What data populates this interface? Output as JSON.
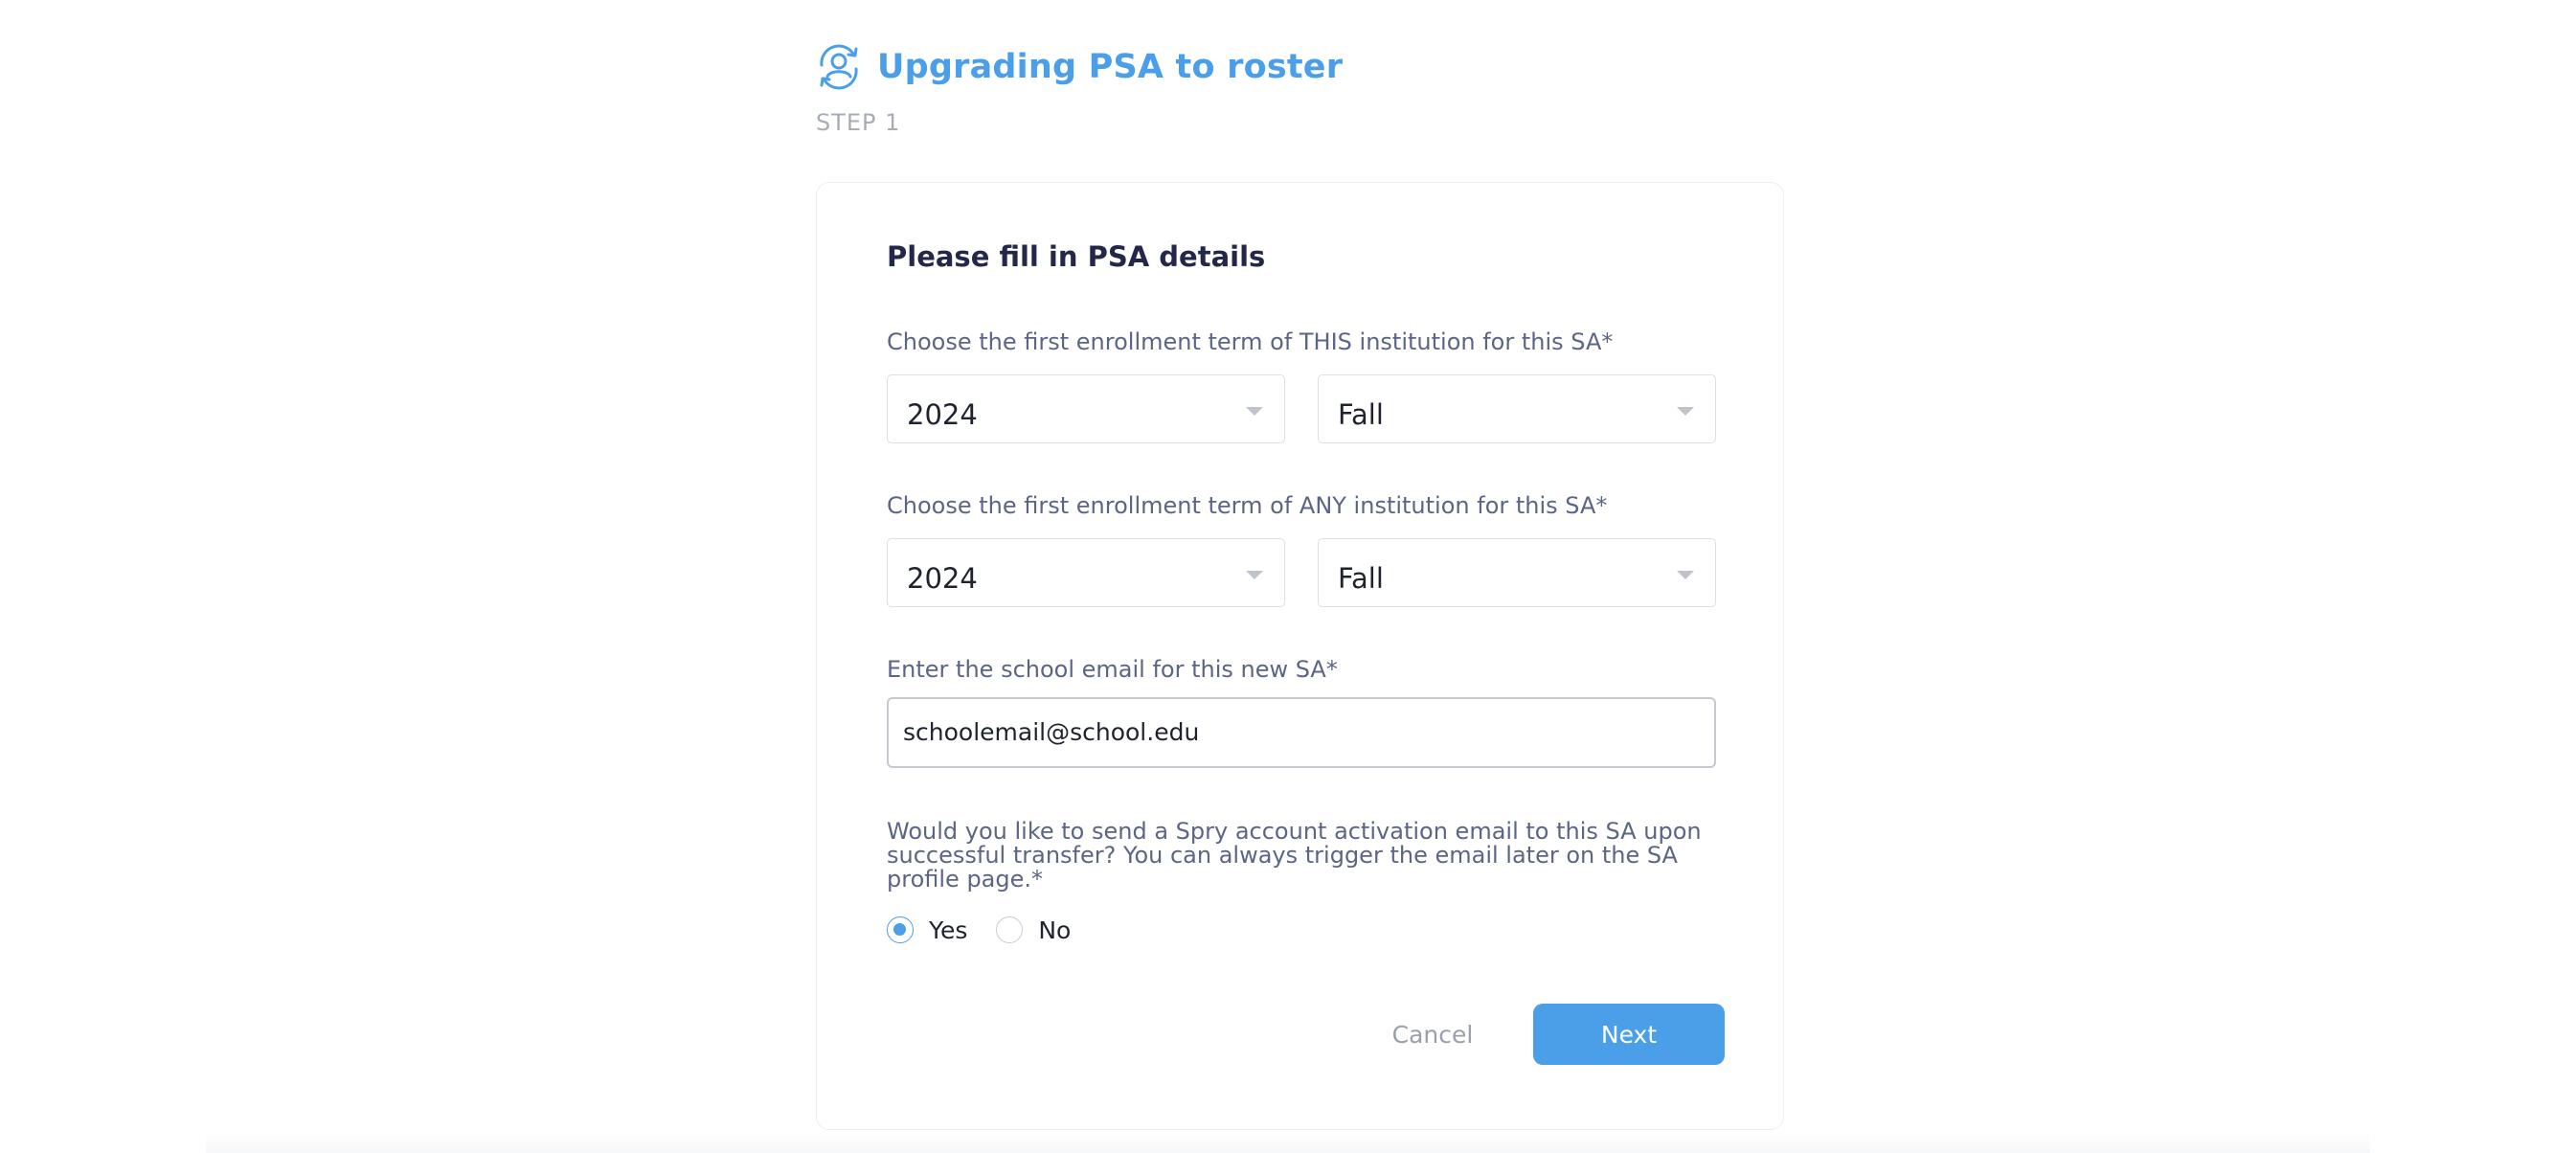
{
  "header": {
    "icon": "user-sync-icon",
    "title": "Upgrading PSA to roster",
    "step": "STEP  1"
  },
  "form": {
    "title": "Please fill in PSA details",
    "this_institution": {
      "label": "Choose the first enrollment term of THIS institution for this SA*",
      "year": "2024",
      "term": "Fall"
    },
    "any_institution": {
      "label": "Choose the first enrollment term of ANY institution for this SA*",
      "year": "2024",
      "term": "Fall"
    },
    "email": {
      "label": "Enter the school email for this new SA*",
      "value": "schoolemail@school.edu"
    },
    "activation": {
      "question": "Would you like to send a Spry account activation email to this SA upon successful transfer? You can always trigger the email later on the SA profile page.*",
      "options": [
        "Yes",
        "No"
      ],
      "selected": "Yes"
    },
    "cancel_label": "Cancel",
    "next_label": "Next"
  },
  "colors": {
    "accent": "#4a9fe8",
    "title_dark": "#23284a",
    "label": "#5b6586"
  }
}
